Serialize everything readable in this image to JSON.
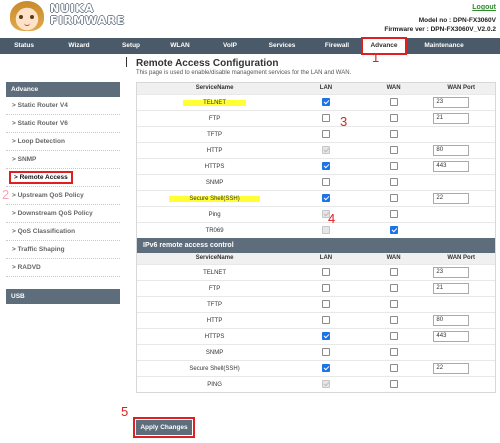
{
  "header": {
    "logo_text_line1": "NUIKA",
    "logo_text_line2": "FIRMWARE",
    "logout": "Logout",
    "model": "Model no : DPN-FX3060V",
    "firmware": "Firmware ver : DPN-FX3060V_V2.0.2"
  },
  "nav": {
    "items": [
      "Status",
      "Wizard",
      "Setup",
      "WLAN",
      "VoIP",
      "Services",
      "Firewall",
      "Advance",
      "Maintenance"
    ],
    "active": "Advance"
  },
  "sidebar": {
    "section": "Advance",
    "items": [
      "Static Router V4",
      "Static Router V6",
      "Loop Detection",
      "SNMP",
      "Remote Access",
      "Upstream QoS Policy",
      "Downstream QoS Policy",
      "QoS Classification",
      "Traffic Shaping",
      "RADVD"
    ],
    "selected": "Remote Access",
    "usb": "USB",
    "bullet": ">"
  },
  "main": {
    "title": "Remote Access Configuration",
    "description": "This page is used to enable/disable management services for the LAN and WAN.",
    "columns": [
      "ServiceName",
      "LAN",
      "WAN",
      "WAN Port"
    ],
    "ipv4_rows": [
      {
        "name": "TELNET",
        "lan": true,
        "lan_disabled": false,
        "wan": false,
        "wan_disabled": false,
        "port": "23",
        "highlight": true
      },
      {
        "name": "FTP",
        "lan": false,
        "lan_disabled": false,
        "wan": false,
        "wan_disabled": false,
        "port": "21",
        "highlight": false
      },
      {
        "name": "TFTP",
        "lan": false,
        "lan_disabled": false,
        "wan": false,
        "wan_disabled": false,
        "port": "",
        "highlight": false
      },
      {
        "name": "HTTP",
        "lan": true,
        "lan_disabled": true,
        "wan": false,
        "wan_disabled": false,
        "port": "80",
        "highlight": false
      },
      {
        "name": "HTTPS",
        "lan": true,
        "lan_disabled": false,
        "wan": false,
        "wan_disabled": false,
        "port": "443",
        "highlight": false
      },
      {
        "name": "SNMP",
        "lan": false,
        "lan_disabled": false,
        "wan": false,
        "wan_disabled": false,
        "port": "",
        "highlight": false
      },
      {
        "name": "Secure Shell(SSH)",
        "lan": true,
        "lan_disabled": false,
        "wan": false,
        "wan_disabled": false,
        "port": "22",
        "highlight": true
      },
      {
        "name": "Ping",
        "lan": true,
        "lan_disabled": true,
        "wan": false,
        "wan_disabled": false,
        "port": "",
        "highlight": false
      },
      {
        "name": "TR069",
        "lan": false,
        "lan_disabled": true,
        "wan": true,
        "wan_disabled": false,
        "port": "",
        "highlight": false
      }
    ],
    "ipv6_title": "IPv6 remote access control",
    "ipv6_rows": [
      {
        "name": "TELNET",
        "lan": false,
        "lan_disabled": false,
        "wan": false,
        "wan_disabled": false,
        "port": "23"
      },
      {
        "name": "FTP",
        "lan": false,
        "lan_disabled": false,
        "wan": false,
        "wan_disabled": false,
        "port": "21"
      },
      {
        "name": "TFTP",
        "lan": false,
        "lan_disabled": false,
        "wan": false,
        "wan_disabled": false,
        "port": ""
      },
      {
        "name": "HTTP",
        "lan": false,
        "lan_disabled": false,
        "wan": false,
        "wan_disabled": false,
        "port": "80"
      },
      {
        "name": "HTTPS",
        "lan": true,
        "lan_disabled": false,
        "wan": false,
        "wan_disabled": false,
        "port": "443"
      },
      {
        "name": "SNMP",
        "lan": false,
        "lan_disabled": false,
        "wan": false,
        "wan_disabled": false,
        "port": ""
      },
      {
        "name": "Secure Shell(SSH)",
        "lan": true,
        "lan_disabled": false,
        "wan": false,
        "wan_disabled": false,
        "port": "22"
      },
      {
        "name": "PING",
        "lan": true,
        "lan_disabled": true,
        "wan": false,
        "wan_disabled": false,
        "port": ""
      }
    ],
    "apply_label": "Apply Changes"
  },
  "annotations": {
    "n1": "1",
    "n2": "2",
    "n3": "3",
    "n4": "4",
    "n5": "5"
  },
  "colors": {
    "nav_bg": "#4b5a69",
    "accent_red": "#e02020",
    "highlight_yellow": "#ffff33",
    "checkbox_blue": "#1a73e8"
  }
}
